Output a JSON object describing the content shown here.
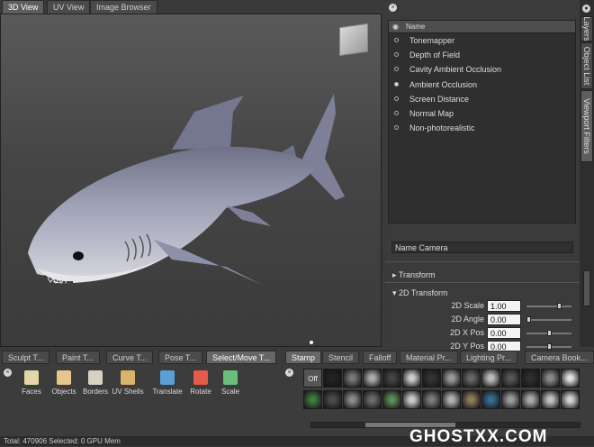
{
  "view_tabs": [
    "3D View",
    "UV View",
    "Image Browser"
  ],
  "side_tabs": [
    "Layers",
    "Object List",
    "Viewport Filters"
  ],
  "filters": {
    "header": "Name",
    "items": [
      {
        "label": "Tonemapper",
        "on": false
      },
      {
        "label": "Depth of Field",
        "on": false
      },
      {
        "label": "Cavity Ambient Occlusion",
        "on": false
      },
      {
        "label": "Ambient Occlusion",
        "on": true
      },
      {
        "label": "Screen Distance",
        "on": false
      },
      {
        "label": "Normal Map",
        "on": false
      },
      {
        "label": "Non-photorealistic",
        "on": false
      }
    ]
  },
  "properties": {
    "name_value": "Name Camera",
    "transform_label": "Transform",
    "transform2d_label": "2D Transform",
    "fields": [
      {
        "label": "2D Scale",
        "value": "1.00",
        "level": 0.75
      },
      {
        "label": "2D Angle",
        "value": "0.00",
        "level": 0.0
      },
      {
        "label": "2D X Pos",
        "value": "0.00",
        "level": 0.5
      },
      {
        "label": "2D Y Pos",
        "value": "0.00",
        "level": 0.5
      }
    ]
  },
  "tool_tabs": [
    "Sculpt T...",
    "Paint T...",
    "Curve T...",
    "Pose T...",
    "Select/Move T..."
  ],
  "tools": [
    "Faces",
    "Objects",
    "Borders",
    "UV Shells",
    "Translate",
    "Rotate",
    "Scale"
  ],
  "stamp_tabs": [
    "Stamp",
    "Stencil",
    "Falloff",
    "Material Pr...",
    "Lighting Pr...",
    "Camera Book..."
  ],
  "stamp_off_label": "Off",
  "status": {
    "text": "Total: 470906   Selected: 0   GPU Mem"
  },
  "watermark": "GHOSTXX.COM",
  "colors": {
    "accent": "#5e5e5e",
    "panel": "#3b3b3b",
    "shark": "#8d8fa8"
  }
}
